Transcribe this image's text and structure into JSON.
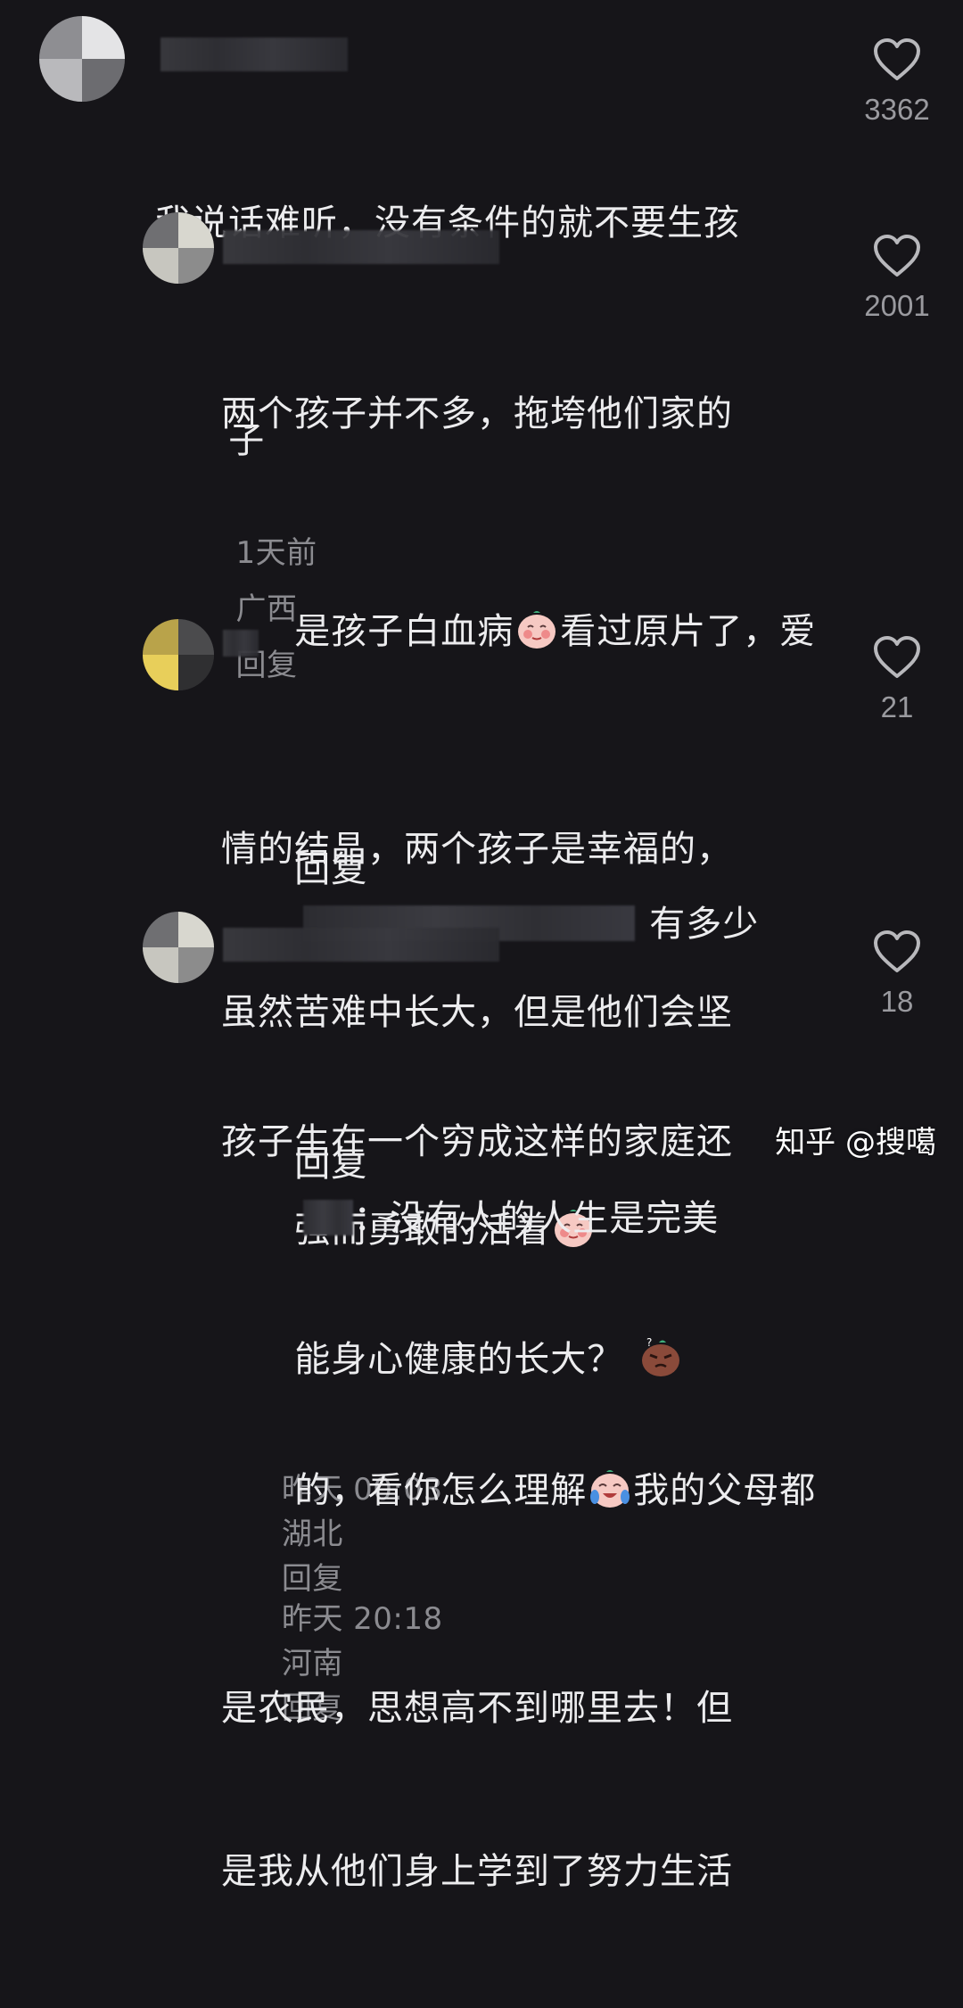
{
  "comments": [
    {
      "text": "我说话难听，没有条件的就不要生孩子",
      "text_line1": "我说话难听，没有条件的就不要生孩",
      "text_line2": "子",
      "time": "1天前",
      "location": "广西",
      "reply_label": "回复",
      "likes": "3362"
    },
    {
      "line1": "两个孩子并不多，拖垮他们家的",
      "line2a": "是孩子白血病",
      "line2b": "看过原片了，爱",
      "line3": "情的结晶，两个孩子是幸福的，",
      "line4": "虽然苦难中长大，但是他们会坚",
      "line5": "强而勇敢的活着",
      "emoji": "shy-face-emoji",
      "time": "昨天 00:03",
      "location": "湖北",
      "reply_label": "回复",
      "likes": "2001"
    },
    {
      "prefix": "回复",
      "line1_end": "有多少",
      "line2": "孩子生在一个穷成这样的家庭还",
      "line3": "能身心健康的长大？",
      "emoji": "confused-face-emoji",
      "time": "昨天 20:18",
      "location": "河南",
      "reply_label": "回复",
      "likes": "21"
    },
    {
      "prefix": "回复",
      "line1_end": "：没有人的人生是完美",
      "line2a": "的，看你怎么理解",
      "line2b": "我的父母都",
      "line3": "是农民，思想高不到哪里去！但",
      "line4": "是我从他们身上学到了努力生活",
      "emoji": "crying-laugh-emoji",
      "likes": "18"
    }
  ],
  "watermark": "知乎 @搜噶",
  "colors": {
    "background": "#161519",
    "text": "#ececee",
    "meta": "#8b8b90"
  }
}
